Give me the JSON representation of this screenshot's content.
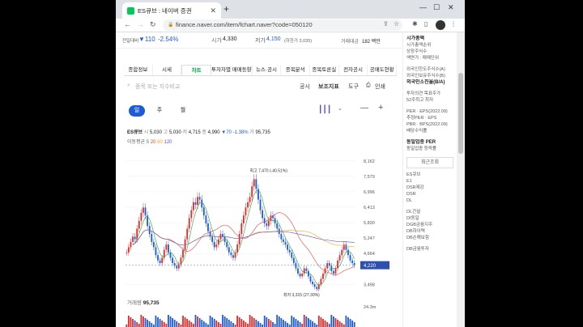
{
  "browser": {
    "tab_title": "ES큐브 : 네이버 증권",
    "url": "finance.naver.com/item/fchart.naver?code=050120"
  },
  "pricebar": {
    "prev_label": "전일대비",
    "prev_change": "▼110",
    "pct": "-2.54%",
    "open_label": "시가",
    "open": "4,330",
    "low_label": "저가",
    "low": "4,150",
    "low_note": "(하한가 3,035)",
    "amount_label": "거래대금",
    "amount": "182 백만"
  },
  "sidebar": {
    "items": [
      "시가총액",
      "시가총액순위",
      "상장주식수",
      "액면가 : 매매단위",
      "",
      "외국인한도주식수(A)",
      "외국인보유주식수(B)",
      "외국인소진율(B/A)",
      "",
      "투자의견   목표주가",
      "52주최고   최저",
      "",
      "PER · EPS(2022.09)",
      "추정PER · EPS",
      "PBR · BPS(2022.09)",
      "배당수익률",
      "",
      "동일업종 PER",
      "동일업종 등락률"
    ],
    "recent_title": "최근조회",
    "recent": [
      "ES큐브",
      "E1",
      "DSR제강",
      "DSR",
      "DL",
      "",
      "DL건설",
      "DI동일",
      "DGB금융지주",
      "DB하이텍",
      "DB손해보험",
      "",
      "DB금융투자"
    ]
  },
  "tabs": [
    "종합정보",
    "시세",
    "차트",
    "투자자별 매매동향",
    "뉴스·공시",
    "종목분석",
    "종목토론실",
    "전자공시",
    "공매도현황"
  ],
  "active_tab": 2,
  "search_placeholder": "종목 또는 지수비교",
  "toolbar": {
    "notice": "공시",
    "indicator": "보조지표",
    "tools": "도구",
    "print": "인쇄"
  },
  "periods": [
    "일",
    "주",
    "월"
  ],
  "ohlc": {
    "name": "ES큐브",
    "s_label": "시",
    "s": "5,030",
    "g_label": "고",
    "g": "5,030",
    "j_label": "저",
    "j": "4,715",
    "e_label": "종",
    "e": "4,990",
    "chg": "▼70",
    "chg_pct": "-1.38%",
    "v_label": "거",
    "v": "95,735"
  },
  "ma": {
    "label": "이동평균",
    "v1": "5",
    "v2": "20",
    "v3": "60",
    "v4": "120"
  },
  "chart_data": {
    "type": "candlestick",
    "scale": "Linear",
    "ylim": [
      3200,
      8400
    ],
    "yticks": [
      "8,162",
      "7,579",
      "6,996",
      "6,413",
      "5,830",
      "5,247",
      "4,664",
      "3,498"
    ],
    "current": "4,220",
    "max_label": "최고 7,470 (-40.51%)",
    "min_label": "최저 3,315 (27.30%)",
    "close": [
      4700,
      4900,
      5100,
      5300,
      5200,
      5600,
      5900,
      6200,
      6400,
      6100,
      5700,
      5400,
      5100,
      4900,
      4600,
      4400,
      4300,
      4500,
      4800,
      5000,
      4700,
      4500,
      4300,
      4200,
      4100,
      4250,
      4500,
      4800,
      5200,
      5600,
      6000,
      6300,
      6600,
      6500,
      6800,
      6700,
      6400,
      6100,
      5800,
      5500,
      5300,
      5100,
      4900,
      5000,
      5200,
      5400,
      5300,
      5100,
      4900,
      4700,
      4600,
      4500,
      4700,
      5000,
      5400,
      5800,
      6100,
      6400,
      6600,
      6800,
      7200,
      7470,
      7100,
      6700,
      6300,
      6000,
      5800,
      5700,
      5900,
      6100,
      6000,
      5800,
      5600,
      5400,
      5200,
      5100,
      5000,
      4800,
      4700,
      4500,
      4300,
      4100,
      3900,
      3800,
      3900,
      4100,
      4000,
      3800,
      3600,
      3500,
      3400,
      3315,
      3500,
      3700,
      3900,
      4100,
      4300,
      4200,
      4000,
      3900,
      4100,
      4400,
      4600,
      4800,
      5000,
      4800,
      4600,
      4400,
      4300,
      4220
    ],
    "ma_colors": [
      "#2e9e3f",
      "#e64040",
      "#ff9d1a",
      "#5a52c8"
    ]
  },
  "volume": {
    "label": "거래량",
    "value": "95,735",
    "axis": "24.3m"
  }
}
